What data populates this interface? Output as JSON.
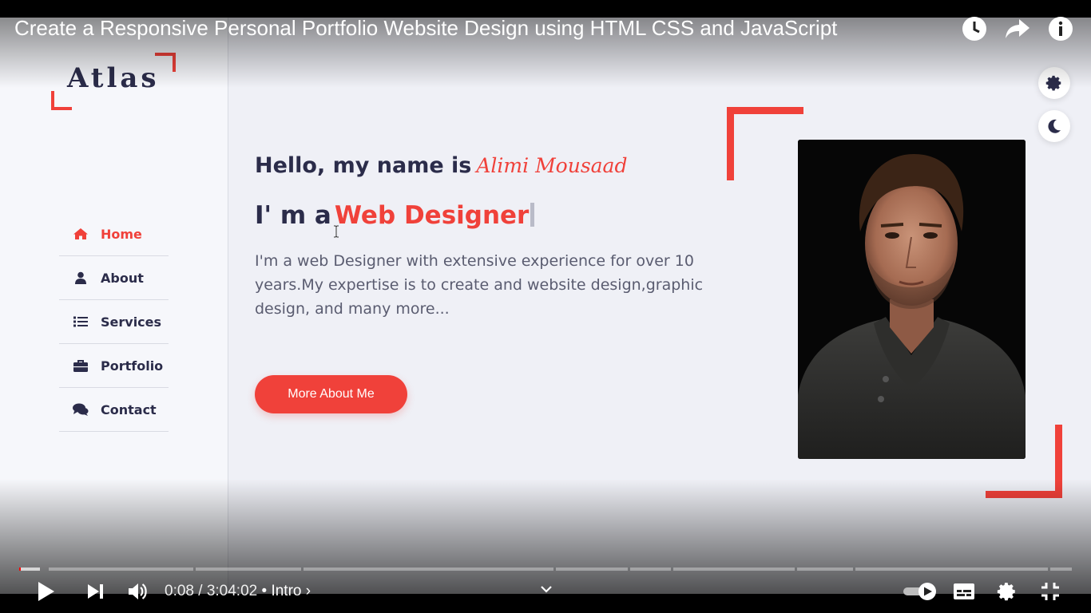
{
  "video": {
    "title": "Create a Responsive Personal Portfolio Website Design using HTML CSS and JavaScript",
    "current_time": "0:08",
    "time_separator": " / ",
    "duration": "3:04:02",
    "chapter": " • Intro ›",
    "progress_fraction": 0.0019,
    "autoplay": "on"
  },
  "site": {
    "logo": "Atlas",
    "nav": [
      {
        "label": "Home",
        "icon": "home-icon",
        "active": true
      },
      {
        "label": "About",
        "icon": "user-icon",
        "active": false
      },
      {
        "label": "Services",
        "icon": "list-icon",
        "active": false
      },
      {
        "label": "Portfolio",
        "icon": "briefcase-icon",
        "active": false
      },
      {
        "label": "Contact",
        "icon": "comments-icon",
        "active": false
      }
    ],
    "hero": {
      "greeting": "Hello, my name is",
      "name": "Alimi Mousaad",
      "role_prefix": "I' m a",
      "role": "Web Designer",
      "description": "I'm a web Designer with extensive experience for over 10 years.My expertise is to create and website design,graphic design, and many more...",
      "button_label": "More About Me"
    }
  },
  "colors": {
    "accent": "#f0413a",
    "text_dark": "#2b2c4a",
    "background": "#eff0f6",
    "youtube_red": "#ff0000"
  }
}
